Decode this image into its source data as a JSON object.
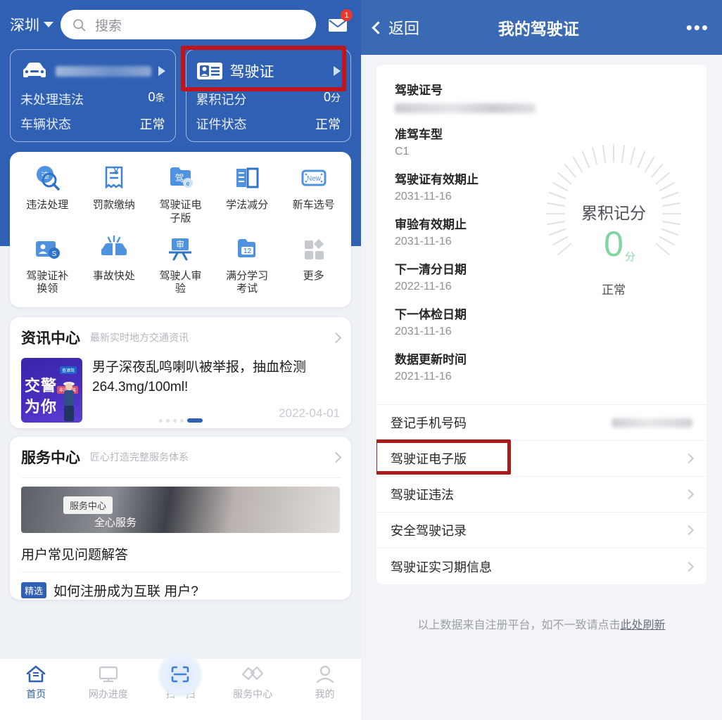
{
  "left": {
    "topbar": {
      "city": "深圳",
      "search_placeholder": "搜索",
      "mail_badge": "1"
    },
    "status_cards": [
      {
        "title": "",
        "title_blurred": true,
        "rows": [
          {
            "label": "未处理违法",
            "value": "0",
            "unit": "条"
          },
          {
            "label": "车辆状态",
            "value": "正常",
            "unit": ""
          }
        ]
      },
      {
        "title": "驾驶证",
        "title_blurred": false,
        "highlighted": true,
        "rows": [
          {
            "label": "累积记分",
            "value": "0",
            "unit": "分"
          },
          {
            "label": "证件状态",
            "value": "正常",
            "unit": ""
          }
        ]
      }
    ],
    "grid": [
      {
        "label": "违法处理",
        "icon": "violation-search-icon"
      },
      {
        "label": "罚款缴纳",
        "icon": "fine-payment-icon"
      },
      {
        "label": "驾驶证电子版",
        "icon": "e-license-icon"
      },
      {
        "label": "学法减分",
        "icon": "study-book-icon"
      },
      {
        "label": "新车选号",
        "icon": "new-plate-icon"
      },
      {
        "label": "驾驶证补换领",
        "icon": "license-renew-icon"
      },
      {
        "label": "事故快处",
        "icon": "accident-icon"
      },
      {
        "label": "驾驶人审验",
        "icon": "driver-review-icon"
      },
      {
        "label": "满分学习考试",
        "icon": "twelve-points-icon"
      },
      {
        "label": "更多",
        "icon": "more-grid-icon"
      }
    ],
    "news": {
      "title": "资讯中心",
      "subtitle": "最新实时地方交通资讯",
      "item_title": "男子深夜乱鸣喇叭被举报，抽血检测264.3mg/100ml!",
      "item_date": "2022-04-01",
      "thumb_line1": "交警",
      "thumb_line2": "为你",
      "thumb_chip1": "查酒驾",
      "thumb_chip2": "非法鸣笛",
      "dots_count": 5,
      "dots_active": 4
    },
    "service": {
      "title": "服务中心",
      "subtitle": "匠心打造完整服务体系",
      "banner_chip": "服务中心",
      "banner_text": "全心服务",
      "faq_heading": "用户常见问题解答",
      "faq_badge": "精选",
      "faq_text": "如何注册成为互联       用户?"
    },
    "tabbar": [
      {
        "label": "首页",
        "icon": "home-icon",
        "active": true
      },
      {
        "label": "网办进度",
        "icon": "monitor-icon",
        "active": false
      },
      {
        "label": "扫一扫",
        "icon": "scan-icon",
        "active": false
      },
      {
        "label": "服务中心",
        "icon": "handshake-icon",
        "active": false
      },
      {
        "label": "我的",
        "icon": "person-icon",
        "active": false
      }
    ]
  },
  "right": {
    "header": {
      "back_label": "返回",
      "title": "我的驾驶证",
      "more_icon": "more-dots-icon"
    },
    "fields": [
      {
        "label": "驾驶证号",
        "value": "",
        "blurred": true
      },
      {
        "label": "准驾车型",
        "value": "C1",
        "blurred": false
      },
      {
        "label": "驾驶证有效期止",
        "value": "2031-11-16",
        "blurred": false
      },
      {
        "label": "审验有效期止",
        "value": "2031-11-16",
        "blurred": false
      },
      {
        "label": "下一清分日期",
        "value": "2022-11-16",
        "blurred": false
      },
      {
        "label": "下一体检日期",
        "value": "2031-11-16",
        "blurred": false
      },
      {
        "label": "数据更新时间",
        "value": "2021-11-16",
        "blurred": false
      }
    ],
    "gauge": {
      "label": "累积记分",
      "value": "0",
      "unit": "分",
      "status": "正常",
      "value_color": "#7fd6a2"
    },
    "rows": [
      {
        "label": "登记手机号码",
        "value_blurred": true,
        "chevron": false,
        "highlighted": false
      },
      {
        "label": "驾驶证电子版",
        "value_blurred": false,
        "chevron": true,
        "highlighted": true
      },
      {
        "label": "驾驶证违法",
        "value_blurred": false,
        "chevron": true,
        "highlighted": false
      },
      {
        "label": "安全驾驶记录",
        "value_blurred": false,
        "chevron": true,
        "highlighted": false
      },
      {
        "label": "驾驶证实习期信息",
        "value_blurred": false,
        "chevron": true,
        "highlighted": false
      }
    ],
    "footer": {
      "text": "以上数据来自注册平台，如不一致请点击",
      "link": "此处刷新"
    }
  },
  "colors": {
    "brand_blue": "#2f60b3",
    "header_blue": "#3a6ab3",
    "highlight_red": "#c0151a",
    "green": "#7fd6a2",
    "badge_red": "#e8392f"
  }
}
